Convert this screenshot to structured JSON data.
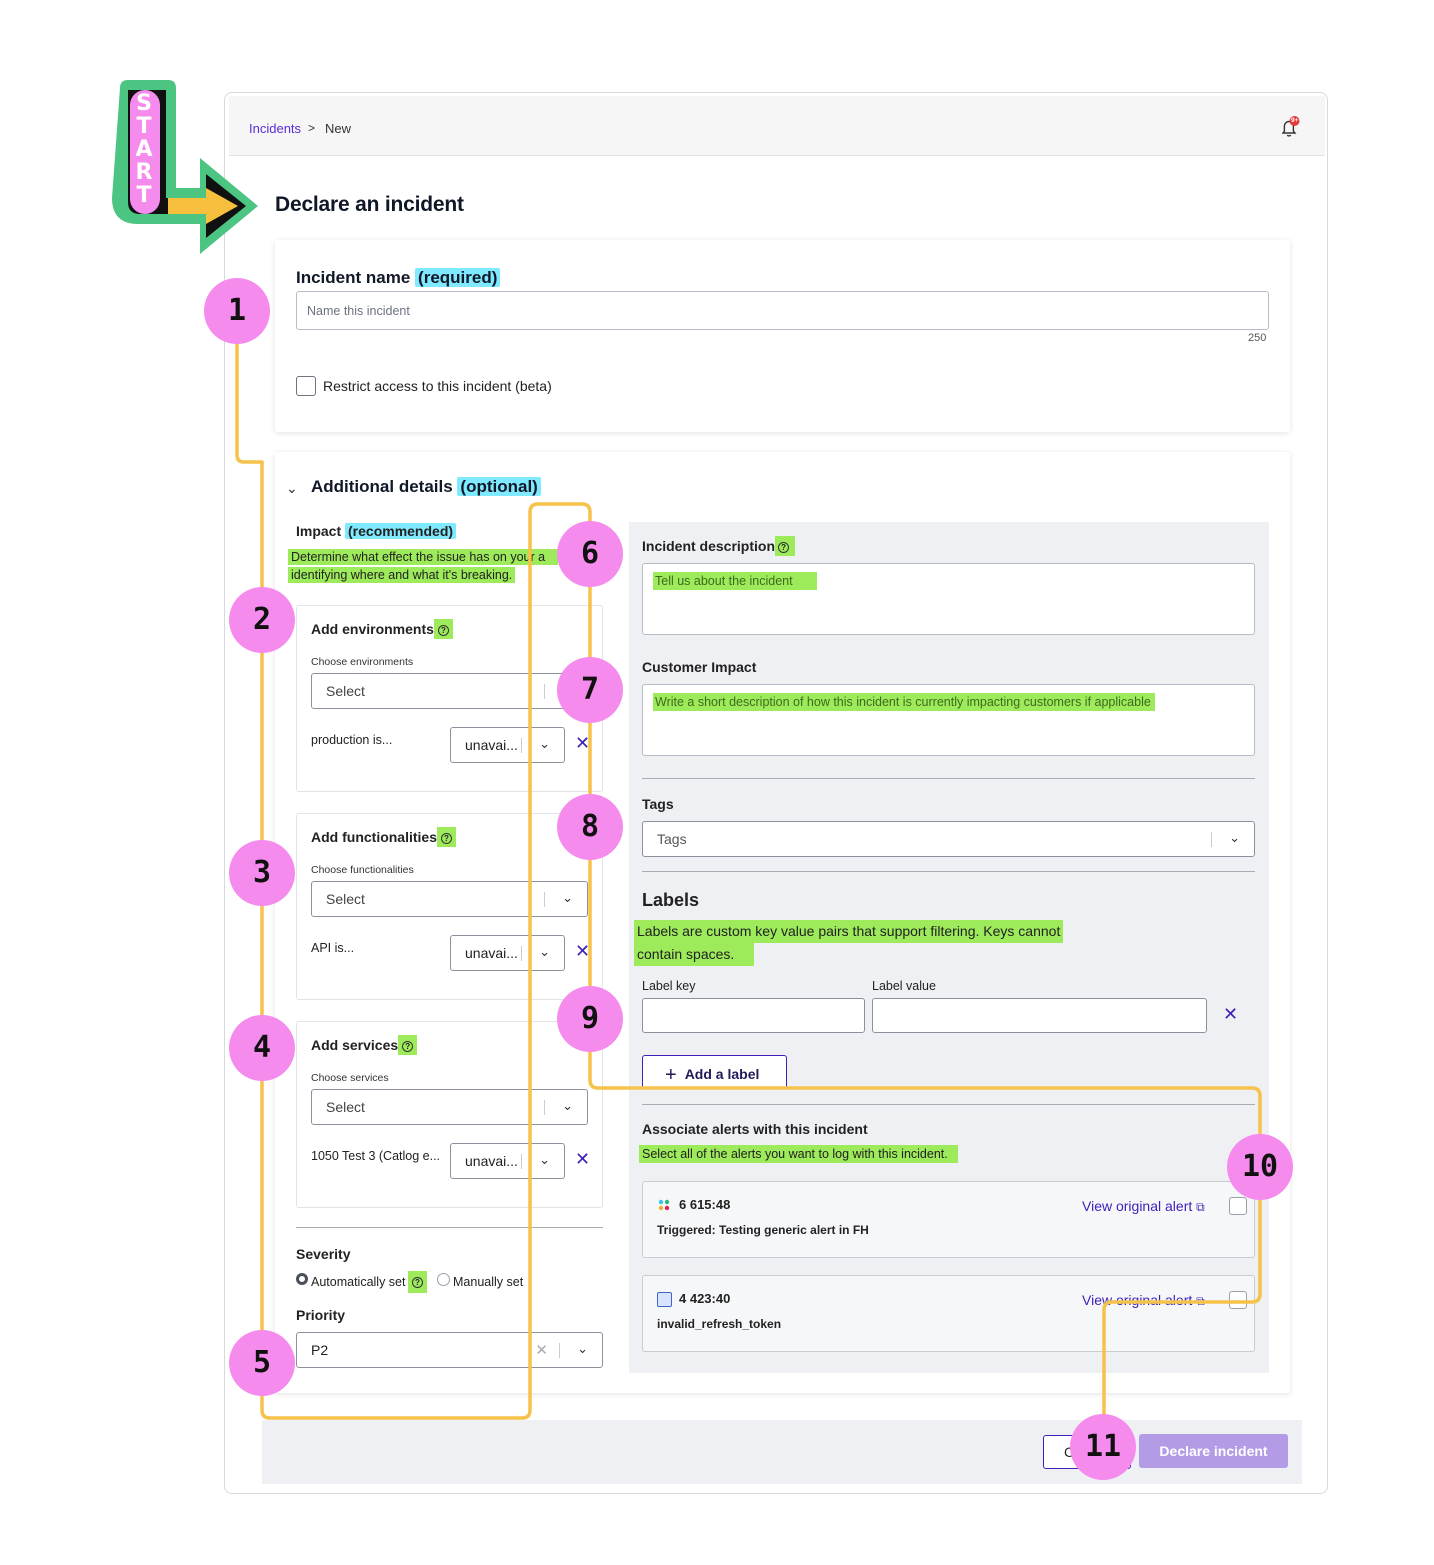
{
  "start_badge": {
    "letters": [
      "S",
      "T",
      "A",
      "R",
      "T"
    ]
  },
  "breadcrumb": {
    "parent": "Incidents",
    "separator": ">",
    "current": "New"
  },
  "notifications": {
    "badge": "9+"
  },
  "page": {
    "title": "Declare an incident"
  },
  "incident_name": {
    "label": "Incident name",
    "required": "(required)",
    "placeholder": "Name this incident",
    "counter": "250",
    "restrict_label": "Restrict access to this incident (beta)"
  },
  "additional": {
    "title": "Additional details",
    "optional": "(optional)",
    "impact_title": "Impact",
    "impact_recommended": "(recommended)",
    "impact_desc_1": "Determine what effect the issue has on your a",
    "impact_desc_2": "identifying where and what it's breaking.",
    "environments": {
      "title": "Add environments",
      "help": "?",
      "choose": "Choose environments",
      "select": "Select",
      "item": "production is...",
      "item_value": "unavai..."
    },
    "functionalities": {
      "title": "Add functionalities",
      "help": "?",
      "choose": "Choose functionalities",
      "select": "Select",
      "item": "API is...",
      "item_value": "unavai..."
    },
    "services": {
      "title": "Add services",
      "help": "?",
      "choose": "Choose services",
      "select": "Select",
      "item": "1050 Test 3 (Catlog e...",
      "item_value": "unavai..."
    },
    "severity": {
      "title": "Severity",
      "auto": "Automatically set",
      "manual": "Manually set"
    },
    "priority": {
      "title": "Priority",
      "value": "P2"
    }
  },
  "right_panel": {
    "description": {
      "title": "Incident description",
      "placeholder": "Tell us about the incident"
    },
    "customer_impact": {
      "title": "Customer Impact",
      "placeholder": "Write a short description of how this incident is currently impacting customers if applicable"
    },
    "tags": {
      "title": "Tags",
      "placeholder": "Tags"
    },
    "labels": {
      "title": "Labels",
      "desc_1": "Labels are custom key value pairs that support filtering. Keys cannot",
      "desc_2": "contain spaces.",
      "key_label": "Label key",
      "value_label": "Label value",
      "add_button": "Add a label"
    },
    "alerts": {
      "title": "Associate alerts with this incident",
      "desc": "Select all of the alerts you want to log with this incident.",
      "items": [
        {
          "id": "6 615:48",
          "title": "Triggered: Testing generic alert in FH",
          "link": "View original alert"
        },
        {
          "id": "4 423:40",
          "title": "invalid_refresh_token",
          "link": "View original alert"
        }
      ]
    }
  },
  "footer": {
    "cancel": "Cancel",
    "declare": "Declare incident"
  },
  "annotations": [
    "1",
    "2",
    "3",
    "4",
    "5",
    "6",
    "7",
    "8",
    "9",
    "10",
    "11"
  ],
  "colors": {
    "accent": "#3f1fb8",
    "pin": "#f68bee",
    "path": "#f5c24a",
    "highlight_green": "#9dea5a",
    "highlight_cyan": "#7fe9ff"
  }
}
